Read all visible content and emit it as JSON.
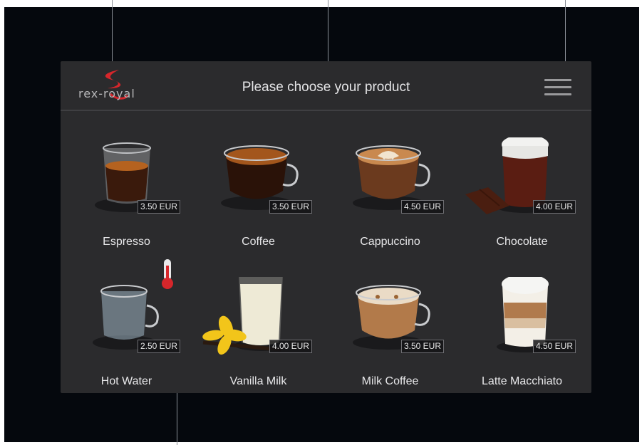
{
  "header": {
    "logo_text": "rex-royal",
    "title": "Please choose your product",
    "menu_icon": "hamburger-menu-icon"
  },
  "products": [
    {
      "name": "Espresso",
      "price": "3.50 EUR",
      "icon": "espresso-cup-icon"
    },
    {
      "name": "Coffee",
      "price": "3.50 EUR",
      "icon": "coffee-cup-icon"
    },
    {
      "name": "Cappuccino",
      "price": "4.50 EUR",
      "icon": "cappuccino-cup-icon"
    },
    {
      "name": "Chocolate",
      "price": "4.00 EUR",
      "icon": "chocolate-glass-icon"
    },
    {
      "name": "Hot Water",
      "price": "2.50 EUR",
      "icon": "hot-water-cup-icon"
    },
    {
      "name": "Vanilla Milk",
      "price": "4.00 EUR",
      "icon": "vanilla-milk-glass-icon"
    },
    {
      "name": "Milk Coffee",
      "price": "3.50 EUR",
      "icon": "milk-coffee-cup-icon"
    },
    {
      "name": "Latte Macchiato",
      "price": "4.50 EUR",
      "icon": "latte-macchiato-glass-icon"
    }
  ],
  "colors": {
    "screen_bg": "#2b2b2d",
    "frame_bg": "#05080d",
    "logo_red": "#d6262b",
    "price_bg": "#141416"
  }
}
